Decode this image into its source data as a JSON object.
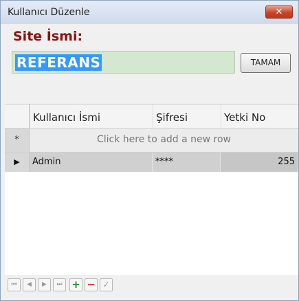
{
  "window": {
    "title": "Kullanıcı Düzenle",
    "close_glyph": "✕"
  },
  "form": {
    "site_label": "Site İsmi:",
    "site_value": "REFERANS",
    "ok_button": "TAMAM"
  },
  "grid": {
    "columns": [
      "Kullanıcı İsmi",
      "Şifresi",
      "Yetki No"
    ],
    "new_row_text": "Click here to add a new row",
    "new_row_indicator": "*",
    "current_row_indicator": "▶",
    "rows": [
      {
        "name": "Admin",
        "password": "****",
        "level": "255"
      }
    ]
  },
  "navigator": {
    "first": "⏮",
    "prev": "◀",
    "next": "▶",
    "last": "⏭",
    "add": "+",
    "delete": "−",
    "apply": "✓"
  },
  "colors": {
    "label_red": "#8b1010",
    "input_bg": "#d3e8cf",
    "selection": "#3399ff",
    "close_red": "#c9452a"
  }
}
